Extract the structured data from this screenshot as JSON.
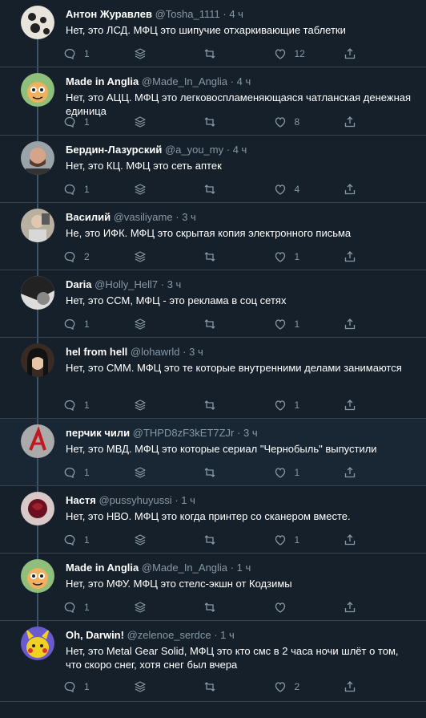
{
  "tweets": [
    {
      "name": "Антон Журавлев",
      "handle": "@Tosha_1111",
      "dot": "·",
      "time": "4 ч",
      "text": "Нет, это ЛСД. МФЦ это шипучие отхаркивающие таблетки",
      "reply": "1",
      "retweet": "",
      "like": "12",
      "avatar": "avatar-dalmatian",
      "avatar_color": "#e8e4dc"
    },
    {
      "name": "Made in Anglia",
      "handle": "@Made_In_Anglia",
      "dot": "·",
      "time": "4 ч",
      "text": "Нет, это АЦЦ. МФЦ это легковоспламеняющаяся чатланская денежная единица",
      "reply": "1",
      "retweet": "",
      "like": "8",
      "avatar": "avatar-cartoon",
      "avatar_color": "#8fbf7a"
    },
    {
      "name": "Бердин-Лазурский",
      "handle": "@a_you_my",
      "dot": "·",
      "time": "4 ч",
      "text": "Нет, это КЦ. МФЦ это сеть аптек",
      "reply": "1",
      "retweet": "",
      "like": "4",
      "avatar": "avatar-man",
      "avatar_color": "#8a6a5a"
    },
    {
      "name": "Василий",
      "handle": "@vasiliyame",
      "dot": "·",
      "time": "3 ч",
      "text": "Не, это ИФК. МФЦ это скрытая копия электронного письма",
      "reply": "2",
      "retweet": "",
      "like": "1",
      "avatar": "avatar-photo",
      "avatar_color": "#b8b0a0"
    },
    {
      "name": "Daria",
      "handle": "@Holly_Hell7",
      "dot": "·",
      "time": "3 ч",
      "text": "Нет, это ССМ, МФЦ - это реклама в соц сетях",
      "reply": "1",
      "retweet": "",
      "like": "1",
      "avatar": "avatar-bw",
      "avatar_color": "#cccccc"
    },
    {
      "name": "hel from hell",
      "handle": "@lohawrld",
      "dot": "·",
      "time": "3 ч",
      "text": "Нет, это СММ. МФЦ это те которые внутренними делами занимаются",
      "reply": "1",
      "retweet": "",
      "like": "1",
      "avatar": "avatar-girl",
      "avatar_color": "#3a2a24"
    },
    {
      "name": "перчик чили",
      "handle": "@THPD8zF3kET7ZJr",
      "dot": "·",
      "time": "3 ч",
      "text": "Нет, это МВД. МФЦ это которые сериал \"Чернобыль\" выпустили",
      "reply": "1",
      "retweet": "",
      "like": "1",
      "avatar": "avatar-letter",
      "avatar_color": "#aaaaaa"
    },
    {
      "name": "Настя",
      "handle": "@pussyhuyussi",
      "dot": "·",
      "time": "1 ч",
      "text": "Нет, это НВО. МФЦ это когда принтер со сканером вместе.",
      "reply": "1",
      "retweet": "",
      "like": "1",
      "avatar": "avatar-rose",
      "avatar_color": "#6a1020"
    },
    {
      "name": "Made in Anglia",
      "handle": "@Made_In_Anglia",
      "dot": "·",
      "time": "1 ч",
      "text": "Нет, это МФУ. МФЦ это стелс-экшн от Кодзимы",
      "reply": "1",
      "retweet": "",
      "like": "",
      "avatar": "avatar-cartoon",
      "avatar_color": "#8fbf7a"
    },
    {
      "name": "Oh, Darwin!",
      "handle": "@zelenoe_serdce",
      "dot": "·",
      "time": "1 ч",
      "text": "Нет, это Metal Gear Solid, МФЦ это кто смс в 2 часа ночи шлёт о том, что скоро снег, хотя снег был вчера",
      "reply": "1",
      "retweet": "",
      "like": "2",
      "avatar": "avatar-pikachu",
      "avatar_color": "#f0d020"
    }
  ],
  "icons": {
    "reply": "reply-icon",
    "stack": "stack-icon",
    "retweet": "retweet-icon",
    "like": "heart-icon",
    "share": "share-icon"
  }
}
